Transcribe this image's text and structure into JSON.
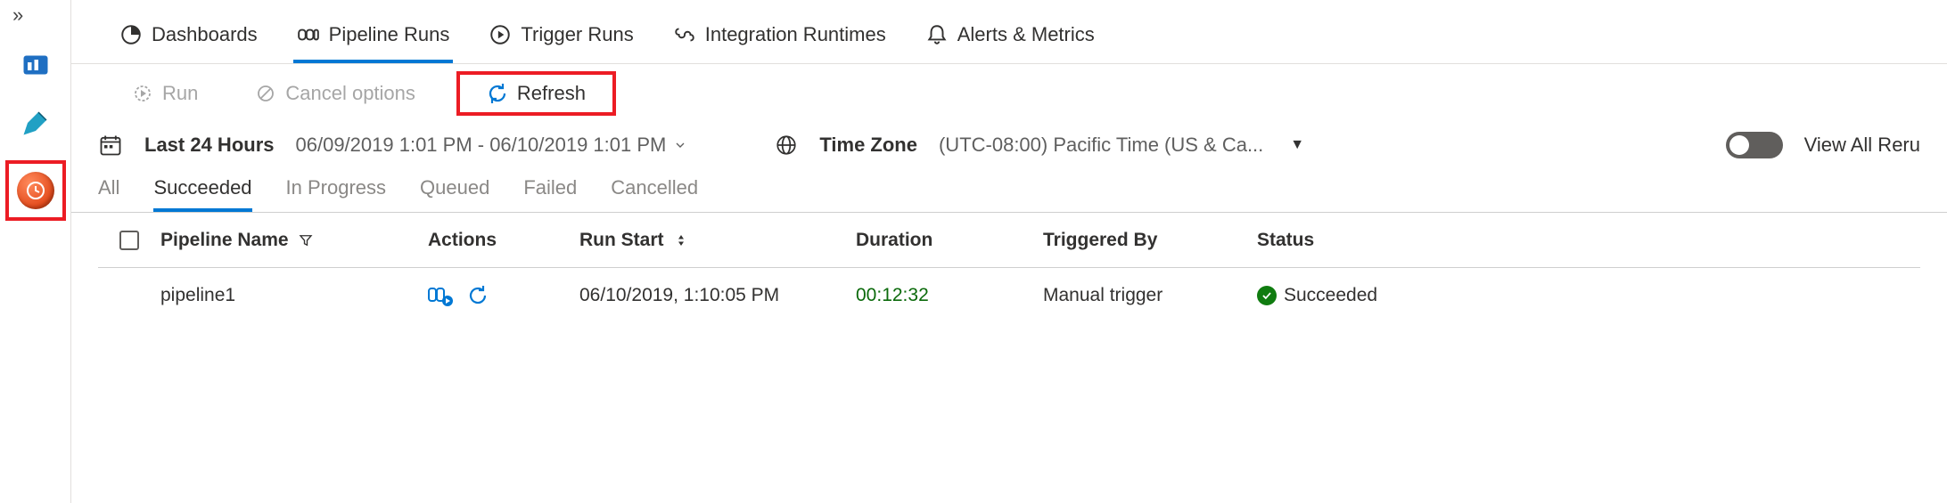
{
  "topTabs": {
    "dashboards": "Dashboards",
    "pipelineRuns": "Pipeline Runs",
    "triggerRuns": "Trigger Runs",
    "integrationRuntimes": "Integration Runtimes",
    "alertsMetrics": "Alerts & Metrics"
  },
  "toolbar": {
    "run": "Run",
    "cancel": "Cancel options",
    "refresh": "Refresh"
  },
  "filters": {
    "timespanLabel": "Last 24 Hours",
    "timespanRange": "06/09/2019 1:01 PM - 06/10/2019 1:01 PM",
    "timezoneLabel": "Time Zone",
    "timezoneValue": "(UTC-08:00) Pacific Time (US & Ca...",
    "viewAll": "View All Reru"
  },
  "statusTabs": {
    "all": "All",
    "succeeded": "Succeeded",
    "inProgress": "In Progress",
    "queued": "Queued",
    "failed": "Failed",
    "cancelled": "Cancelled"
  },
  "table": {
    "headers": {
      "pipelineName": "Pipeline Name",
      "actions": "Actions",
      "runStart": "Run Start",
      "duration": "Duration",
      "triggeredBy": "Triggered By",
      "status": "Status"
    },
    "rows": [
      {
        "name": "pipeline1",
        "runStart": "06/10/2019, 1:10:05 PM",
        "duration": "00:12:32",
        "triggeredBy": "Manual trigger",
        "status": "Succeeded"
      }
    ]
  }
}
